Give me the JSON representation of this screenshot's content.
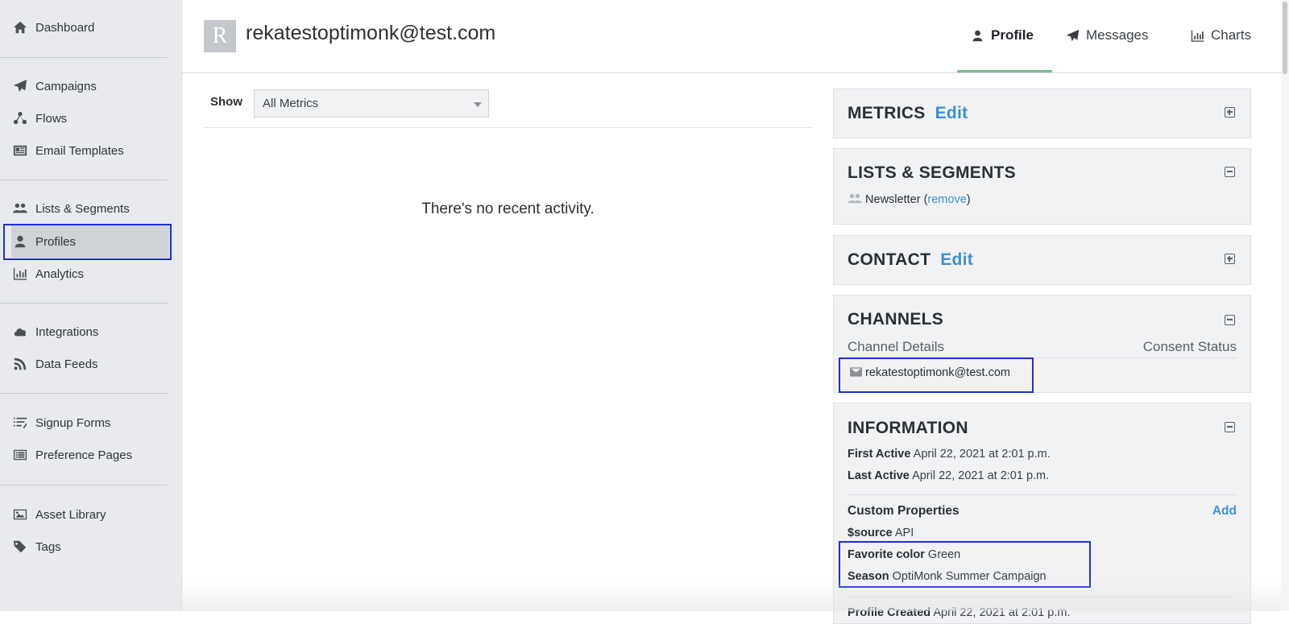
{
  "sidebar": {
    "items": [
      {
        "label": "Dashboard",
        "icon": "home-icon"
      },
      {
        "label": "Campaigns",
        "icon": "paper-plane-icon"
      },
      {
        "label": "Flows",
        "icon": "flow-icon"
      },
      {
        "label": "Email Templates",
        "icon": "newspaper-icon"
      },
      {
        "label": "Lists & Segments",
        "icon": "users-icon"
      },
      {
        "label": "Profiles",
        "icon": "user-icon"
      },
      {
        "label": "Analytics",
        "icon": "bar-chart-icon"
      },
      {
        "label": "Integrations",
        "icon": "cloud-icon"
      },
      {
        "label": "Data Feeds",
        "icon": "rss-icon"
      },
      {
        "label": "Signup Forms",
        "icon": "list-icon"
      },
      {
        "label": "Preference Pages",
        "icon": "list-alt-icon"
      },
      {
        "label": "Asset Library",
        "icon": "image-icon"
      },
      {
        "label": "Tags",
        "icon": "tag-icon"
      }
    ],
    "active": "Profiles"
  },
  "header": {
    "avatar_letter": "R",
    "title": "rekatestoptimonk@test.com",
    "tabs": [
      {
        "label": "Profile",
        "icon": "user-icon",
        "active": true
      },
      {
        "label": "Messages",
        "icon": "paper-plane-icon",
        "active": false
      },
      {
        "label": "Charts",
        "icon": "bar-chart-icon",
        "active": false
      }
    ]
  },
  "main": {
    "show_label": "Show",
    "filter_value": "All Metrics",
    "empty_message": "There's no recent activity."
  },
  "panels": {
    "metrics": {
      "title": "METRICS",
      "edit": "Edit"
    },
    "lists": {
      "title": "LISTS & SEGMENTS",
      "list_name": "Newsletter",
      "paren_open": "(",
      "remove": "remove",
      "paren_close": ")"
    },
    "contact": {
      "title": "CONTACT",
      "edit": "Edit"
    },
    "channels": {
      "title": "CHANNELS",
      "col_details": "Channel Details",
      "col_consent": "Consent Status",
      "email": "rekatestoptimonk@test.com"
    },
    "information": {
      "title": "INFORMATION",
      "first_active_label": "First Active",
      "first_active_value": "April 22, 2021 at 2:01 p.m.",
      "last_active_label": "Last Active",
      "last_active_value": "April 22, 2021 at 2:01 p.m.",
      "custom_props_label": "Custom Properties",
      "add_label": "Add",
      "props": [
        {
          "key": "$source",
          "value": "API"
        },
        {
          "key": "Favorite color",
          "value": "Green"
        },
        {
          "key": "Season",
          "value": "OptiMonk Summer Campaign"
        }
      ],
      "profile_created_label": "Profile Created",
      "profile_created_value": "April 22, 2021 at 2:01 p.m."
    }
  },
  "colors": {
    "accent_link": "#3d8fd1",
    "tab_underline": "#6cc29a",
    "highlight_box": "#1a2fd6",
    "sidebar_bg": "#e8eaed"
  }
}
